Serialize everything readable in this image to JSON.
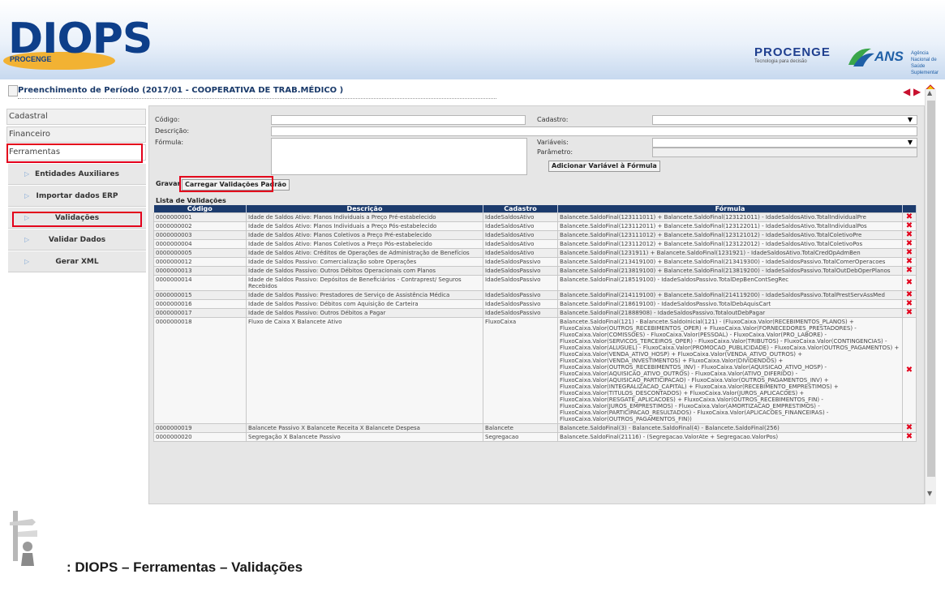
{
  "header": {
    "logo_text": "DIOPS",
    "logo_sub": "PROCENGE",
    "procenge_name": "PROCENGE",
    "procenge_tag": "Tecnologia para decisão",
    "ans_name": "ANS",
    "ans_desc": "Agência Nacional de Saúde Suplementar"
  },
  "page": {
    "title": "Preenchimento de Período (2017/01 - COOPERATIVA DE TRAB.MÉDICO )"
  },
  "sidebar": {
    "items": [
      {
        "label": "Cadastral"
      },
      {
        "label": "Financeiro"
      },
      {
        "label": "Ferramentas"
      }
    ],
    "subitems": [
      {
        "label": "Entidades Auxiliares"
      },
      {
        "label": "Importar dados ERP"
      },
      {
        "label": "Validações"
      },
      {
        "label": "Validar Dados"
      },
      {
        "label": "Gerar XML"
      }
    ]
  },
  "form": {
    "codigo_label": "Código:",
    "descricao_label": "Descrição:",
    "formula_label": "Fórmula:",
    "cadastro_label": "Cadastro:",
    "variaveis_label": "Variáveis:",
    "parametro_label": "Parâmetro:",
    "add_var_button": "Adicionar Variável à Fórmula",
    "save_button": "Gravar",
    "load_button": "Carregar Validações Padrão"
  },
  "list": {
    "title": "Lista de Validações",
    "columns": [
      "Código",
      "Descrição",
      "Cadastro",
      "Fórmula"
    ],
    "rows": [
      [
        "0000000001",
        "Idade de Saldos Ativo: Planos Individuais a Preço Pré-estabelecido",
        "IdadeSaldosAtivo",
        "Balancete.SaldoFinal(123111011) + Balancete.SaldoFinal(123121011) - IdadeSaldosAtivo.TotalIndividualPre"
      ],
      [
        "0000000002",
        "Idade de Saldos Ativo: Planos Individuais a Preço Pós-estabelecido",
        "IdadeSaldosAtivo",
        "Balancete.SaldoFinal(123112011) + Balancete.SaldoFinal(123122011) - IdadeSaldosAtivo.TotalIndividualPos"
      ],
      [
        "0000000003",
        "Idade de Saldos Ativo: Planos Coletivos a Preço Pré-estabelecido",
        "IdadeSaldosAtivo",
        "Balancete.SaldoFinal(123111012) + Balancete.SaldoFinal(123121012) - IdadeSaldosAtivo.TotalColetivoPre"
      ],
      [
        "0000000004",
        "Idade de Saldos Ativo: Planos Coletivos a Preço Pós-estabelecido",
        "IdadeSaldosAtivo",
        "Balancete.SaldoFinal(123112012) + Balancete.SaldoFinal(123122012) - IdadeSaldosAtivo.TotalColetivoPos"
      ],
      [
        "0000000005",
        "Idade de Saldos Ativo: Créditos de Operações de Administração de Benefícios",
        "IdadeSaldosAtivo",
        "Balancete.SaldoFinal(1231911) + Balancete.SaldoFinal(1231921) - IdadeSaldosAtivo.TotalCredOpAdmBen"
      ],
      [
        "0000000012",
        "Idade de Saldos Passivo: Comercialização sobre Operações",
        "IdadeSaldosPassivo",
        "Balancete.SaldoFinal(213419100) + Balancete.SaldoFinal(213419300) - IdadeSaldosPassivo.TotalComerOperacoes"
      ],
      [
        "0000000013",
        "Idade de Saldos Passivo: Outros Débitos Operacionais com Planos",
        "IdadeSaldosPassivo",
        "Balancete.SaldoFinal(213819100) + Balancete.SaldoFinal(213819200) - IdadeSaldosPassivo.TotalOutDebOperPlanos"
      ],
      [
        "0000000014",
        "Idade de Saldos Passivo: Depósitos de Beneficiários - Contraprest/ Seguros Recebidos",
        "IdadeSaldosPassivo",
        "Balancete.SaldoFinal(218519100) - IdadeSaldosPassivo.TotalDepBenContSegRec"
      ],
      [
        "0000000015",
        "Idade de Saldos Passivo: Prestadores de Serviço de Assistência Médica",
        "IdadeSaldosPassivo",
        "Balancete.SaldoFinal(214119100) + Balancete.SaldoFinal(214119200) - IdadeSaldosPassivo.TotalPrestServAssMed"
      ],
      [
        "0000000016",
        "Idade de Saldos Passivo: Débitos com Aquisição de Carteira",
        "IdadeSaldosPassivo",
        "Balancete.SaldoFinal(218619100) - IdadeSaldosPassivo.TotalDebAquisCart"
      ],
      [
        "0000000017",
        "Idade de Saldos Passivo: Outros Débitos a Pagar",
        "IdadeSaldosPassivo",
        "Balancete.SaldoFinal(21888908) - IdadeSaldosPassivo.TotaloutDebPagar"
      ],
      [
        "0000000018",
        "Fluxo de Caixa X Balancete Ativo",
        "FluxoCaixa",
        "Balancete.SaldoFinal(121) - Balancete.SaldoInicial(121) - (FluxoCaixa.Valor(RECEBIMENTOS_PLANOS) + FluxoCaixa.Valor(OUTROS_RECEBIMENTOS_OPER) + FluxoCaixa.Valor(FORNECEDORES_PRESTADORES) - FluxoCaixa.Valor(COMISSOES) - FluxoCaixa.Valor(PESSOAL) - FluxoCaixa.Valor(PRO_LABORE) - FluxoCaixa.Valor(SERVICOS_TERCEIROS_OPER) - FluxoCaixa.Valor(TRIBUTOS) - FluxoCaixa.Valor(CONTINGENCIAS) - FluxoCaixa.Valor(ALUGUEL) - FluxoCaixa.Valor(PROMOCAO_PUBLICIDADE) - FluxoCaixa.Valor(OUTROS_PAGAMENTOS) + FluxoCaixa.Valor(VENDA_ATIVO_HOSP) + FluxoCaixa.Valor(VENDA_ATIVO_OUTROS) + FluxoCaixa.Valor(VENDA_INVESTIMENTOS) + FluxoCaixa.Valor(DIVIDENDOS) + FluxoCaixa.Valor(OUTROS_RECEBIMENTOS_INV) - FluxoCaixa.Valor(AQUISICAO_ATIVO_HOSP) - FluxoCaixa.Valor(AQUISICAO_ATIVO_OUTROS) - FluxoCaixa.Valor(ATIVO_DIFERIDO) - FluxoCaixa.Valor(AQUISICAO_PARTICIPACAO) - FluxoCaixa.Valor(OUTROS_PAGAMENTOS_INV) + FluxoCaixa.Valor(INTEGRALIZACAO_CAPITAL) + FluxoCaixa.Valor(RECEBIMENTO_EMPRESTIMOS) + FluxoCaixa.Valor(TITULOS_DESCONTADOS) + FluxoCaixa.Valor(JUROS_APLICACOES) + FluxoCaixa.Valor(RESGATE_APLICACOES) + FluxoCaixa.Valor(OUTROS_RECEBIMENTOS_FIN) - FluxoCaixa.Valor(JUROS_EMPRESTIMOS) - FluxoCaixa.Valor(AMORTIZACAO_EMPRESTIMOS) - FluxoCaixa.Valor(PARTICIPACAO_RESULTADOS) - FluxoCaixa.Valor(APLICACOES_FINANCEIRAS) - FluxoCaixa.Valor(OUTROS_PAGAMENTOS_FIN))"
      ],
      [
        "0000000019",
        "Balancete Passivo X Balancete Receita X Balancete Despesa",
        "Balancete",
        "Balancete.SaldoFinal(3) - Balancete.SaldoFinal(4) - Balancete.SaldoFinal(256)"
      ],
      [
        "0000000020",
        "Segregação X Balancete Passivo",
        "Segregacao",
        "Balancete.SaldoFinal(21116) - (Segregacao.ValorAte + Segregacao.ValorPos)"
      ]
    ]
  },
  "caption": ": DIOPS – Ferramentas – Validações",
  "colors": {
    "header_blue": "#1c3b6d",
    "highlight_red": "#e3001b",
    "delete_red": "#e3001b"
  }
}
